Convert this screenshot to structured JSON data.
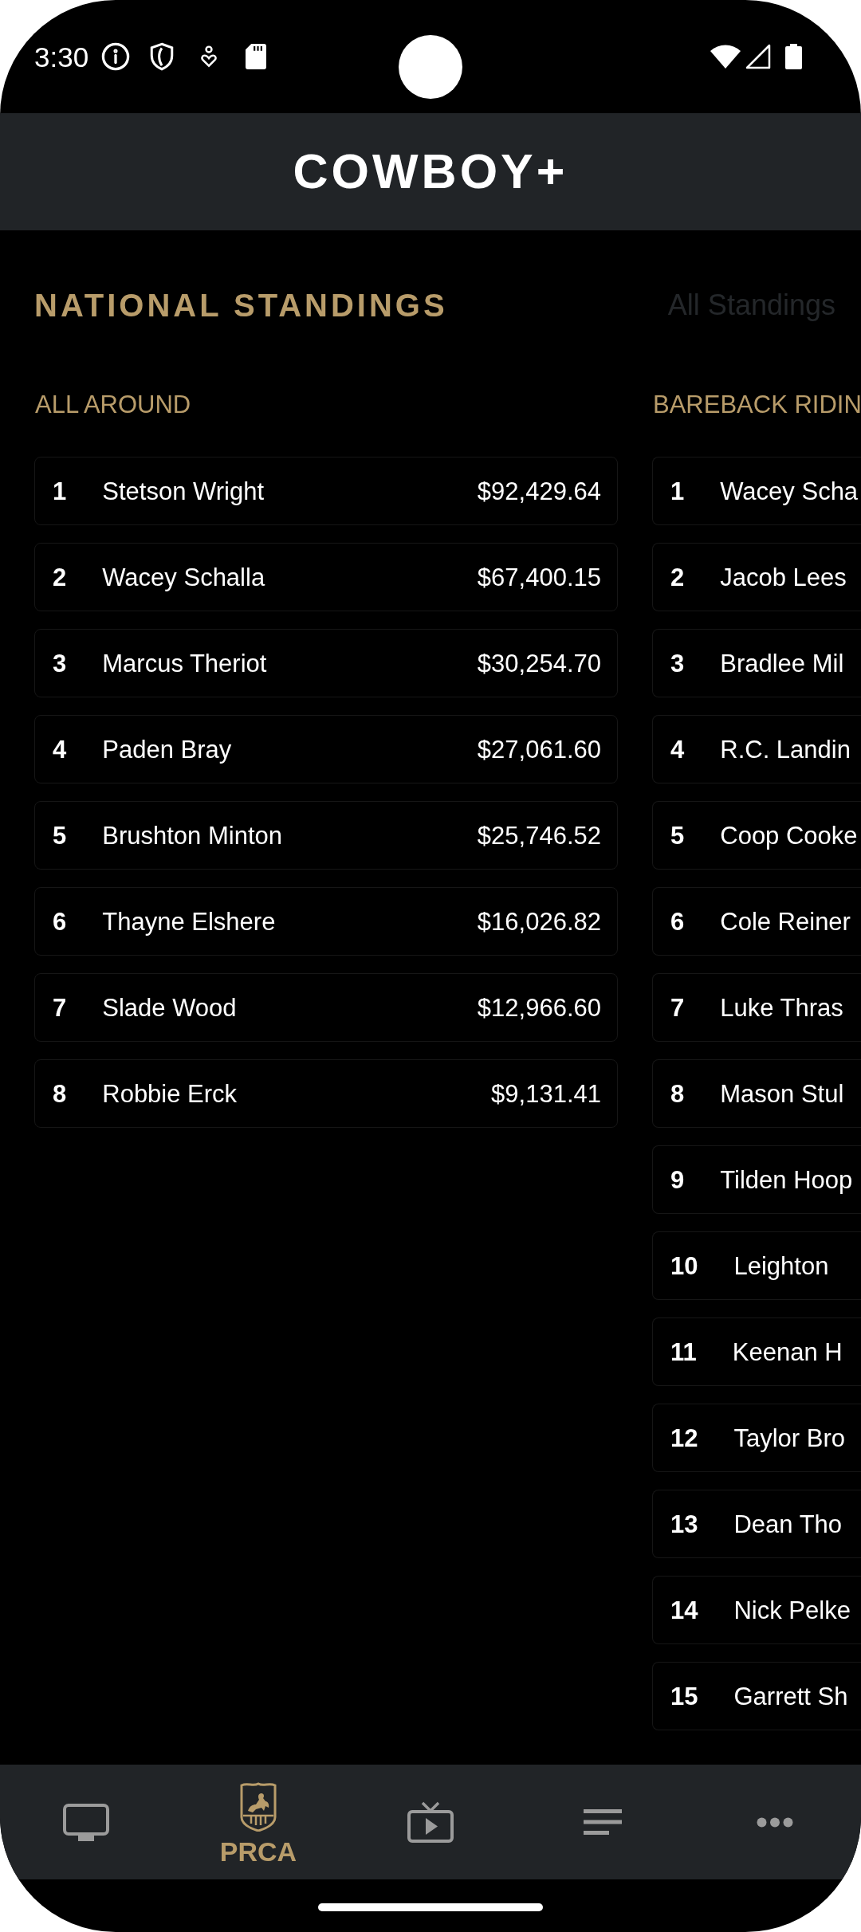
{
  "status_bar": {
    "time": "3:30"
  },
  "header": {
    "logo": "COWBOY+"
  },
  "standings": {
    "title": "NATIONAL STANDINGS",
    "link": "All Standings",
    "events": [
      {
        "title": "ALL AROUND",
        "rows": [
          {
            "rank": "1",
            "name": "Stetson Wright",
            "earnings": "$92,429.64"
          },
          {
            "rank": "2",
            "name": "Wacey Schalla",
            "earnings": "$67,400.15"
          },
          {
            "rank": "3",
            "name": "Marcus Theriot",
            "earnings": "$30,254.70"
          },
          {
            "rank": "4",
            "name": "Paden Bray",
            "earnings": "$27,061.60"
          },
          {
            "rank": "5",
            "name": "Brushton Minton",
            "earnings": "$25,746.52"
          },
          {
            "rank": "6",
            "name": "Thayne Elshere",
            "earnings": "$16,026.82"
          },
          {
            "rank": "7",
            "name": "Slade Wood",
            "earnings": "$12,966.60"
          },
          {
            "rank": "8",
            "name": "Robbie Erck",
            "earnings": "$9,131.41"
          }
        ]
      },
      {
        "title": "BAREBACK RIDIN",
        "rows": [
          {
            "rank": "1",
            "name": "Wacey Scha"
          },
          {
            "rank": "2",
            "name": "Jacob Lees"
          },
          {
            "rank": "3",
            "name": "Bradlee Mil"
          },
          {
            "rank": "4",
            "name": "R.C. Landin"
          },
          {
            "rank": "5",
            "name": "Coop Cooke"
          },
          {
            "rank": "6",
            "name": "Cole Reiner"
          },
          {
            "rank": "7",
            "name": "Luke Thras"
          },
          {
            "rank": "8",
            "name": "Mason Stul"
          },
          {
            "rank": "9",
            "name": "Tilden Hoop"
          },
          {
            "rank": "10",
            "name": "Leighton"
          },
          {
            "rank": "11",
            "name": "Keenan H"
          },
          {
            "rank": "12",
            "name": "Taylor Bro"
          },
          {
            "rank": "13",
            "name": "Dean Tho"
          },
          {
            "rank": "14",
            "name": "Nick Pelke"
          },
          {
            "rank": "15",
            "name": "Garrett Sh"
          }
        ]
      }
    ]
  },
  "bottom_nav": [
    {
      "kind": "monitor",
      "selected": false
    },
    {
      "kind": "rodeo",
      "label": "PRCA",
      "selected": true
    },
    {
      "kind": "tv",
      "selected": false
    },
    {
      "kind": "list",
      "selected": false
    },
    {
      "kind": "more",
      "selected": false
    }
  ]
}
